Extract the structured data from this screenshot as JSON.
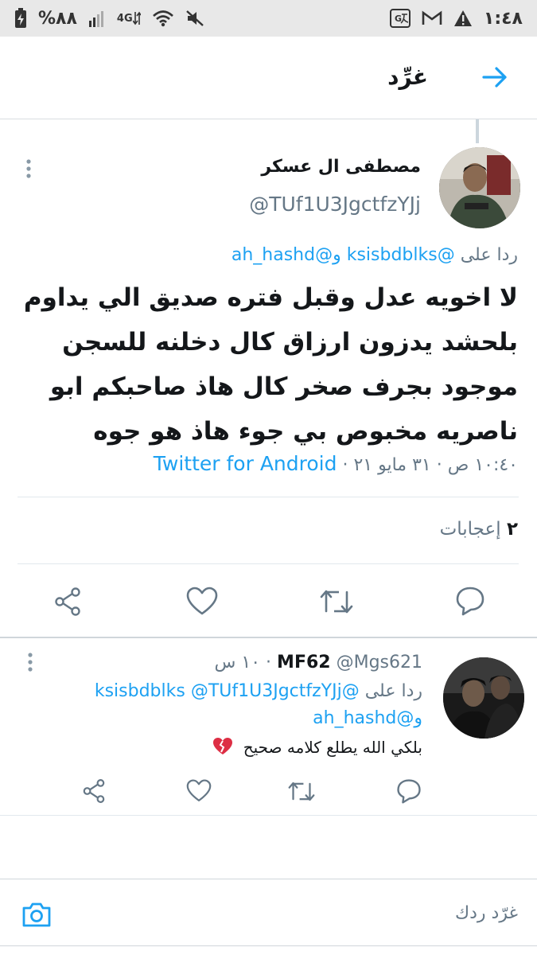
{
  "status_bar": {
    "battery": "%٨٨",
    "network": "4G",
    "time": "١:٤٨"
  },
  "header": {
    "title": "غرِّد"
  },
  "tweet": {
    "author_name": "مصطفى ال عسكر",
    "author_handle": "@TUf1U3JgctfzYJj",
    "reply_prefix": "ردا على",
    "reply_user_1": "@ksisbdblks",
    "reply_and": "و",
    "reply_user_2": "@ah_hashd",
    "text": "لا اخويه عدل وقبل فتره صديق الي يداوم بلحشد يدزون ارزاق كال دخلنه للسجن موجود بجرف صخر كال هاذ صاحبكم ابو ناصريه مخبوص بي جوء هاذ هو جوه",
    "meta_time": "١٠:٤٠ ص · ٣١ مايو ٢١ ·",
    "client": "Twitter for Android",
    "likes_count": "٢",
    "likes_label": "إعجابات"
  },
  "reply": {
    "author_name": "MF62",
    "author_handle": "@Mgs621",
    "time": "· ١٠ س",
    "reply_prefix": "ردا على",
    "reply_user_1": "@TUf1U3JgctfzYJj",
    "reply_user_2": "@ksisbdblks",
    "reply_and": "و",
    "reply_user_3": "@ah_hashd",
    "text": "بلكي الله يطلع كلامه صحيح"
  },
  "compose": {
    "placeholder": "غرّد ردك"
  },
  "colors": {
    "accent": "#1da1f2",
    "muted": "#657786",
    "text": "#14171a",
    "status_bar": "#e8e8e8"
  }
}
